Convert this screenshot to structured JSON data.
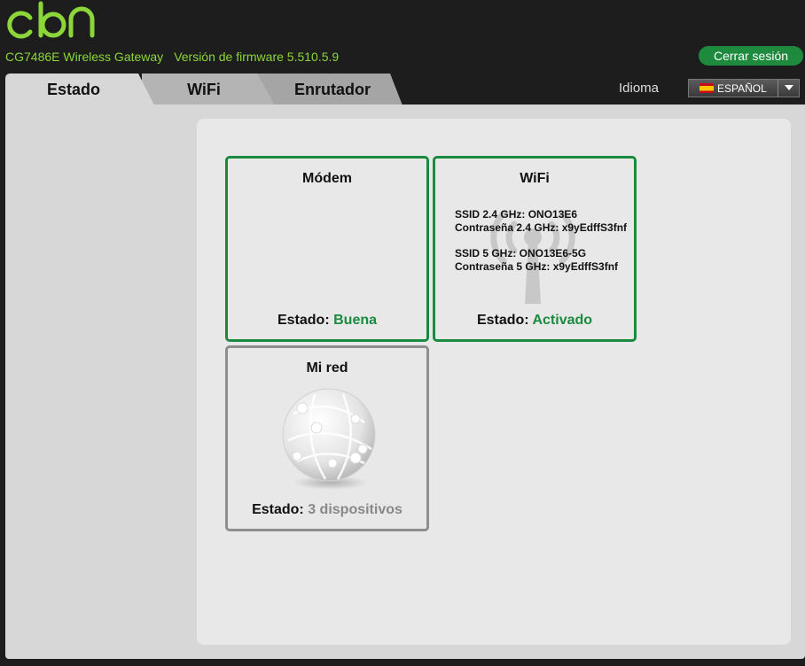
{
  "header": {
    "logo_text": "cbn",
    "model": "CG7486E Wireless Gateway",
    "firmware": "Versión de firmware 5.510.5.9",
    "logout_label": "Cerrar sesión"
  },
  "tabs": [
    {
      "label": "Estado",
      "active": true
    },
    {
      "label": "WiFi",
      "active": false
    },
    {
      "label": "Enrutador",
      "active": false
    }
  ],
  "language": {
    "label": "Idioma",
    "selected": "ESPAÑOL"
  },
  "cards": {
    "modem": {
      "title": "Módem",
      "status_label": "Estado:",
      "status_value": "Buena"
    },
    "wifi": {
      "title": "WiFi",
      "ssid24": "SSID 2.4 GHz: ONO13E6",
      "pass24": "Contraseña 2.4 GHz: x9yEdffS3fnf",
      "ssid5": "SSID 5 GHz: ONO13E6-5G",
      "pass5": "Contraseña 5 GHz: x9yEdffS3fnf",
      "status_label": "Estado:",
      "status_value": "Activado"
    },
    "network": {
      "title": "Mi red",
      "status_label": "Estado:",
      "status_value": "3 dispositivos"
    }
  },
  "colors": {
    "brand_green": "#8cd63a",
    "accent_green": "#1a8a3e"
  }
}
